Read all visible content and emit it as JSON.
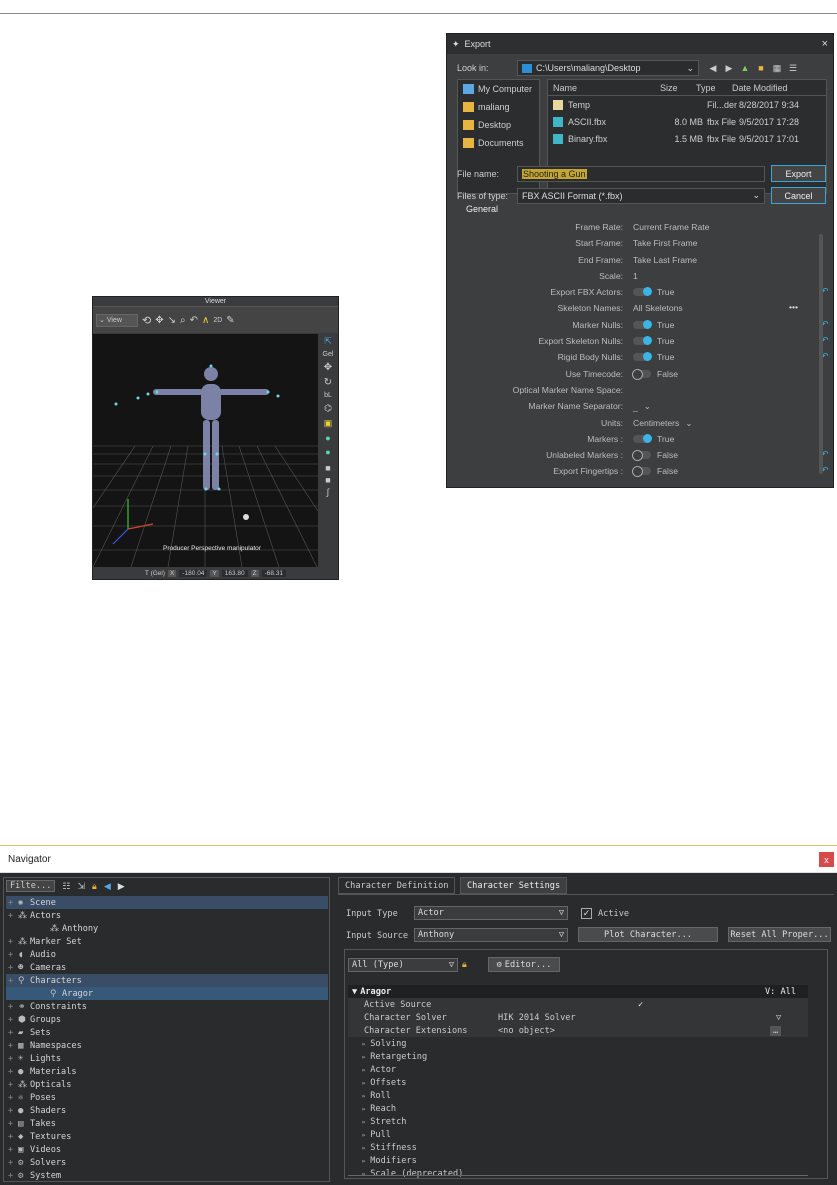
{
  "export": {
    "title": "Export",
    "close": "×",
    "look_in_label": "Look in:",
    "look_in_path": "C:\\Users\\maliang\\Desktop",
    "places": [
      "My Computer",
      "maliang",
      "Desktop",
      "Documents"
    ],
    "columns": [
      "Name",
      "Size",
      "Type",
      "Date Modified"
    ],
    "files": [
      {
        "name": "Temp",
        "size": "",
        "type": "Fil...der",
        "date": "8/28/2017 9:34"
      },
      {
        "name": "ASCII.fbx",
        "size": "8.0 MB",
        "type": "fbx File",
        "date": "9/5/2017 17:28"
      },
      {
        "name": "Binary.fbx",
        "size": "1.5 MB",
        "type": "fbx File",
        "date": "9/5/2017 17:01"
      }
    ],
    "file_name_label": "File name:",
    "file_name_value": "Shooting a Gun",
    "files_of_type_label": "Files of type:",
    "files_of_type_value": "FBX ASCII Format (*.fbx)",
    "export_button": "Export",
    "cancel_button": "Cancel",
    "general_tab": "General",
    "properties": [
      {
        "label": "Frame Rate:",
        "value": "Current Frame Rate"
      },
      {
        "label": "Start Frame:",
        "value": "Take First Frame"
      },
      {
        "label": "End Frame:",
        "value": "Take Last Frame"
      },
      {
        "label": "Scale:",
        "value": "1"
      },
      {
        "label": "Export FBX Actors:",
        "value": "True"
      },
      {
        "label": "Skeleton Names:",
        "value": "All Skeletons"
      },
      {
        "label": "Marker Nulls:",
        "value": "True"
      },
      {
        "label": "Export Skeleton Nulls:",
        "value": "True"
      },
      {
        "label": "Rigid Body Nulls:",
        "value": "True"
      },
      {
        "label": "Use Timecode:",
        "value": "False"
      },
      {
        "label": "Optical Marker Name Space:",
        "value": ""
      },
      {
        "label": "Marker Name Separator:",
        "value": "_"
      },
      {
        "label": "Units:",
        "value": "Centimeters"
      },
      {
        "label": "Markers :",
        "value": "True"
      },
      {
        "label": "Unlabeled Markers :",
        "value": "False"
      },
      {
        "label": "Export Fingertips :",
        "value": "False"
      }
    ],
    "more": "•••"
  },
  "viewer": {
    "title": "Viewer",
    "view_dropdown": "View",
    "overlay_text": "Producer Perspective manipulator",
    "side_labels": [
      "Gel",
      "bL"
    ],
    "status": [
      "T (Gel)",
      "X",
      "-180.04",
      "Y",
      "163.80",
      "Z",
      "-68.31"
    ],
    "tool_2d": "2D"
  },
  "navigator": {
    "title": "Navigator",
    "close": "x",
    "filter": "Filte...",
    "tree": [
      {
        "label": "Scene",
        "indent": 0,
        "sel": "sel2"
      },
      {
        "label": "Actors",
        "indent": 0
      },
      {
        "label": "Anthony",
        "indent": 2
      },
      {
        "label": "Marker Set",
        "indent": 0
      },
      {
        "label": "Audio",
        "indent": 0
      },
      {
        "label": "Cameras",
        "indent": 0
      },
      {
        "label": "Characters",
        "indent": 0,
        "sel": "sel2"
      },
      {
        "label": "Aragor",
        "indent": 2,
        "sel": "sel"
      },
      {
        "label": "Constraints",
        "indent": 0
      },
      {
        "label": "Groups",
        "indent": 0
      },
      {
        "label": "Sets",
        "indent": 0
      },
      {
        "label": "Namespaces",
        "indent": 0
      },
      {
        "label": "Lights",
        "indent": 0
      },
      {
        "label": "Materials",
        "indent": 0
      },
      {
        "label": "Opticals",
        "indent": 0
      },
      {
        "label": "Poses",
        "indent": 0
      },
      {
        "label": "Shaders",
        "indent": 0
      },
      {
        "label": "Takes",
        "indent": 0
      },
      {
        "label": "Textures",
        "indent": 0
      },
      {
        "label": "Videos",
        "indent": 0
      },
      {
        "label": "Solvers",
        "indent": 0
      },
      {
        "label": "System",
        "indent": 0
      }
    ],
    "tabs": [
      "Character Definition",
      "Character Settings"
    ],
    "input_type_label": "Input Type",
    "input_type_value": "Actor",
    "active_label": "Active",
    "input_source_label": "Input Source",
    "input_source_value": "Anthony",
    "plot_button": "Plot Character...",
    "reset_button": "Reset All Proper...",
    "all_type": "All (Type)",
    "editor_button": "Editor...",
    "group_name": "Aragor",
    "v_all": "V: All",
    "rows": [
      {
        "label": "Active Source",
        "value": ""
      },
      {
        "label": "Character Solver",
        "value": "HIK 2014 Solver"
      },
      {
        "label": "Character Extensions",
        "value": "<no object>"
      }
    ],
    "sections": [
      "Solving",
      "Retargeting",
      "Actor",
      "Offsets",
      "Roll",
      "Reach",
      "Stretch",
      "Pull",
      "Stiffness",
      "Modifiers",
      "Scale (deprecated)"
    ]
  }
}
